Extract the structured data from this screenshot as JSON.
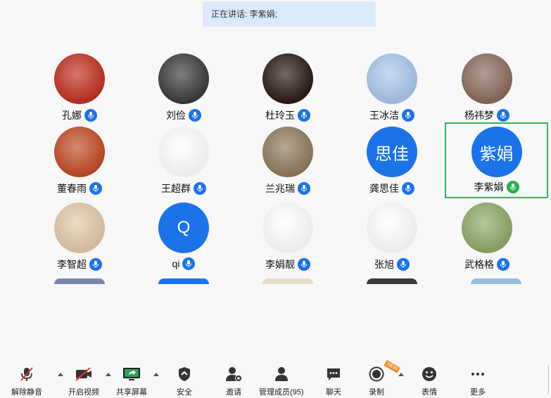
{
  "banner": {
    "text": "正在讲话: 李紫娟;"
  },
  "participants": [
    {
      "name": "孔娜",
      "avatar_text": "",
      "avatar_color": "#c0301f"
    },
    {
      "name": "刘俭",
      "avatar_text": "",
      "avatar_color": "#3a3a3a"
    },
    {
      "name": "杜玲玉",
      "avatar_text": "",
      "avatar_color": "#2a1a14"
    },
    {
      "name": "王冰洁",
      "avatar_text": "",
      "avatar_color": "#a9c6ec"
    },
    {
      "name": "杨祎梦",
      "avatar_text": "",
      "avatar_color": "#8a6a5c"
    },
    {
      "name": "董春雨",
      "avatar_text": "",
      "avatar_color": "#c24a24"
    },
    {
      "name": "王超群",
      "avatar_text": "",
      "avatar_color": "#ffffff"
    },
    {
      "name": "兰兆瑞",
      "avatar_text": "",
      "avatar_color": "#8f7a5c"
    },
    {
      "name": "龚思佳",
      "avatar_text": "思佳",
      "avatar_color": "#1a73e8"
    },
    {
      "name": "李紫娟",
      "avatar_text": "紫娟",
      "avatar_color": "#1a73e8",
      "speaking": true
    },
    {
      "name": "李智超",
      "avatar_text": "",
      "avatar_color": "#e2c8a8"
    },
    {
      "name": "qi",
      "avatar_text": "Q",
      "avatar_color": "#1a73e8"
    },
    {
      "name": "李娟靓",
      "avatar_text": "",
      "avatar_color": "#ffffff"
    },
    {
      "name": "张旭",
      "avatar_text": "",
      "avatar_color": "#ffffff"
    },
    {
      "name": "武格格",
      "avatar_text": "",
      "avatar_color": "#8fa86a"
    }
  ],
  "toolbar": {
    "mute": "解除静音",
    "video": "开启视频",
    "share": "共享屏幕",
    "security": "安全",
    "invite": "邀请",
    "members": "管理成员(95)",
    "chat": "聊天",
    "record": "录制",
    "record_badge": "NEW",
    "reactions": "表情",
    "more": "更多"
  },
  "colors": {
    "accent": "#1a73e8",
    "speaking": "#2fb755",
    "banner_bg": "#dce9fb"
  }
}
